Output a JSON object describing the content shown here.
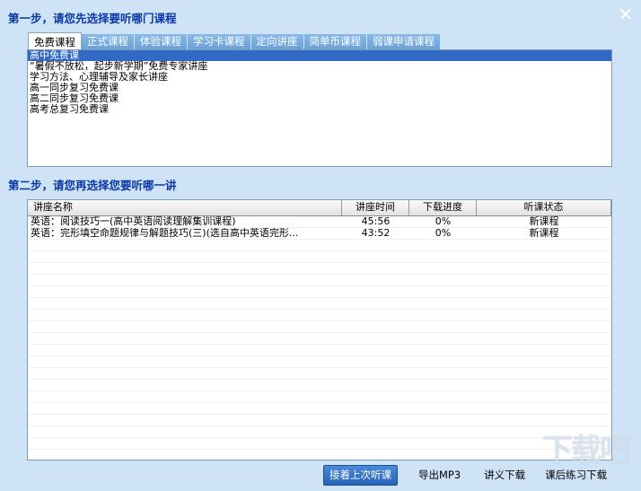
{
  "step1": {
    "title": "第一步，请您先选择要听哪门课程"
  },
  "step2": {
    "title": "第二步，请您再选择您要听哪一讲"
  },
  "close": {
    "glyph": "✕"
  },
  "tabs": [
    {
      "label": "免费课程",
      "active": true
    },
    {
      "label": "正式课程"
    },
    {
      "label": "体验课程"
    },
    {
      "label": "学习卡课程"
    },
    {
      "label": "定向讲座"
    },
    {
      "label": "简单币课程"
    },
    {
      "label": "弱课申请课程"
    }
  ],
  "courses": [
    {
      "label": "高中免费课",
      "selected": true
    },
    {
      "label": "“暑假不放松，起步新学期”免费专家讲座"
    },
    {
      "label": "学习方法、心理辅导及家长讲座"
    },
    {
      "label": "高一同步复习免费课"
    },
    {
      "label": "高二同步复习免费课"
    },
    {
      "label": "高考总复习免费课"
    }
  ],
  "table": {
    "headers": [
      "讲座名称",
      "讲座时间",
      "下载进度",
      "听课状态"
    ],
    "rows": [
      [
        "英语：阅读技巧一(高中英语阅读理解集训课程)",
        "45:56",
        "0%",
        "新课程"
      ],
      [
        "英语：完形填空命题规律与解题技巧(三)(选自高中英语完形...",
        "43:52",
        "0%",
        "新课程"
      ]
    ]
  },
  "actions": {
    "continue": "接着上次听课",
    "export_mp3": "导出MP3",
    "notes_download": "讲义下载",
    "exercise_download": "课后练习下载"
  },
  "watermark": {
    "text": "下载吧"
  },
  "colors": {
    "background": "#cfe3f6",
    "title": "#0a37a8",
    "selection": "#316ac5",
    "primary_button": "#2f6fc2"
  }
}
